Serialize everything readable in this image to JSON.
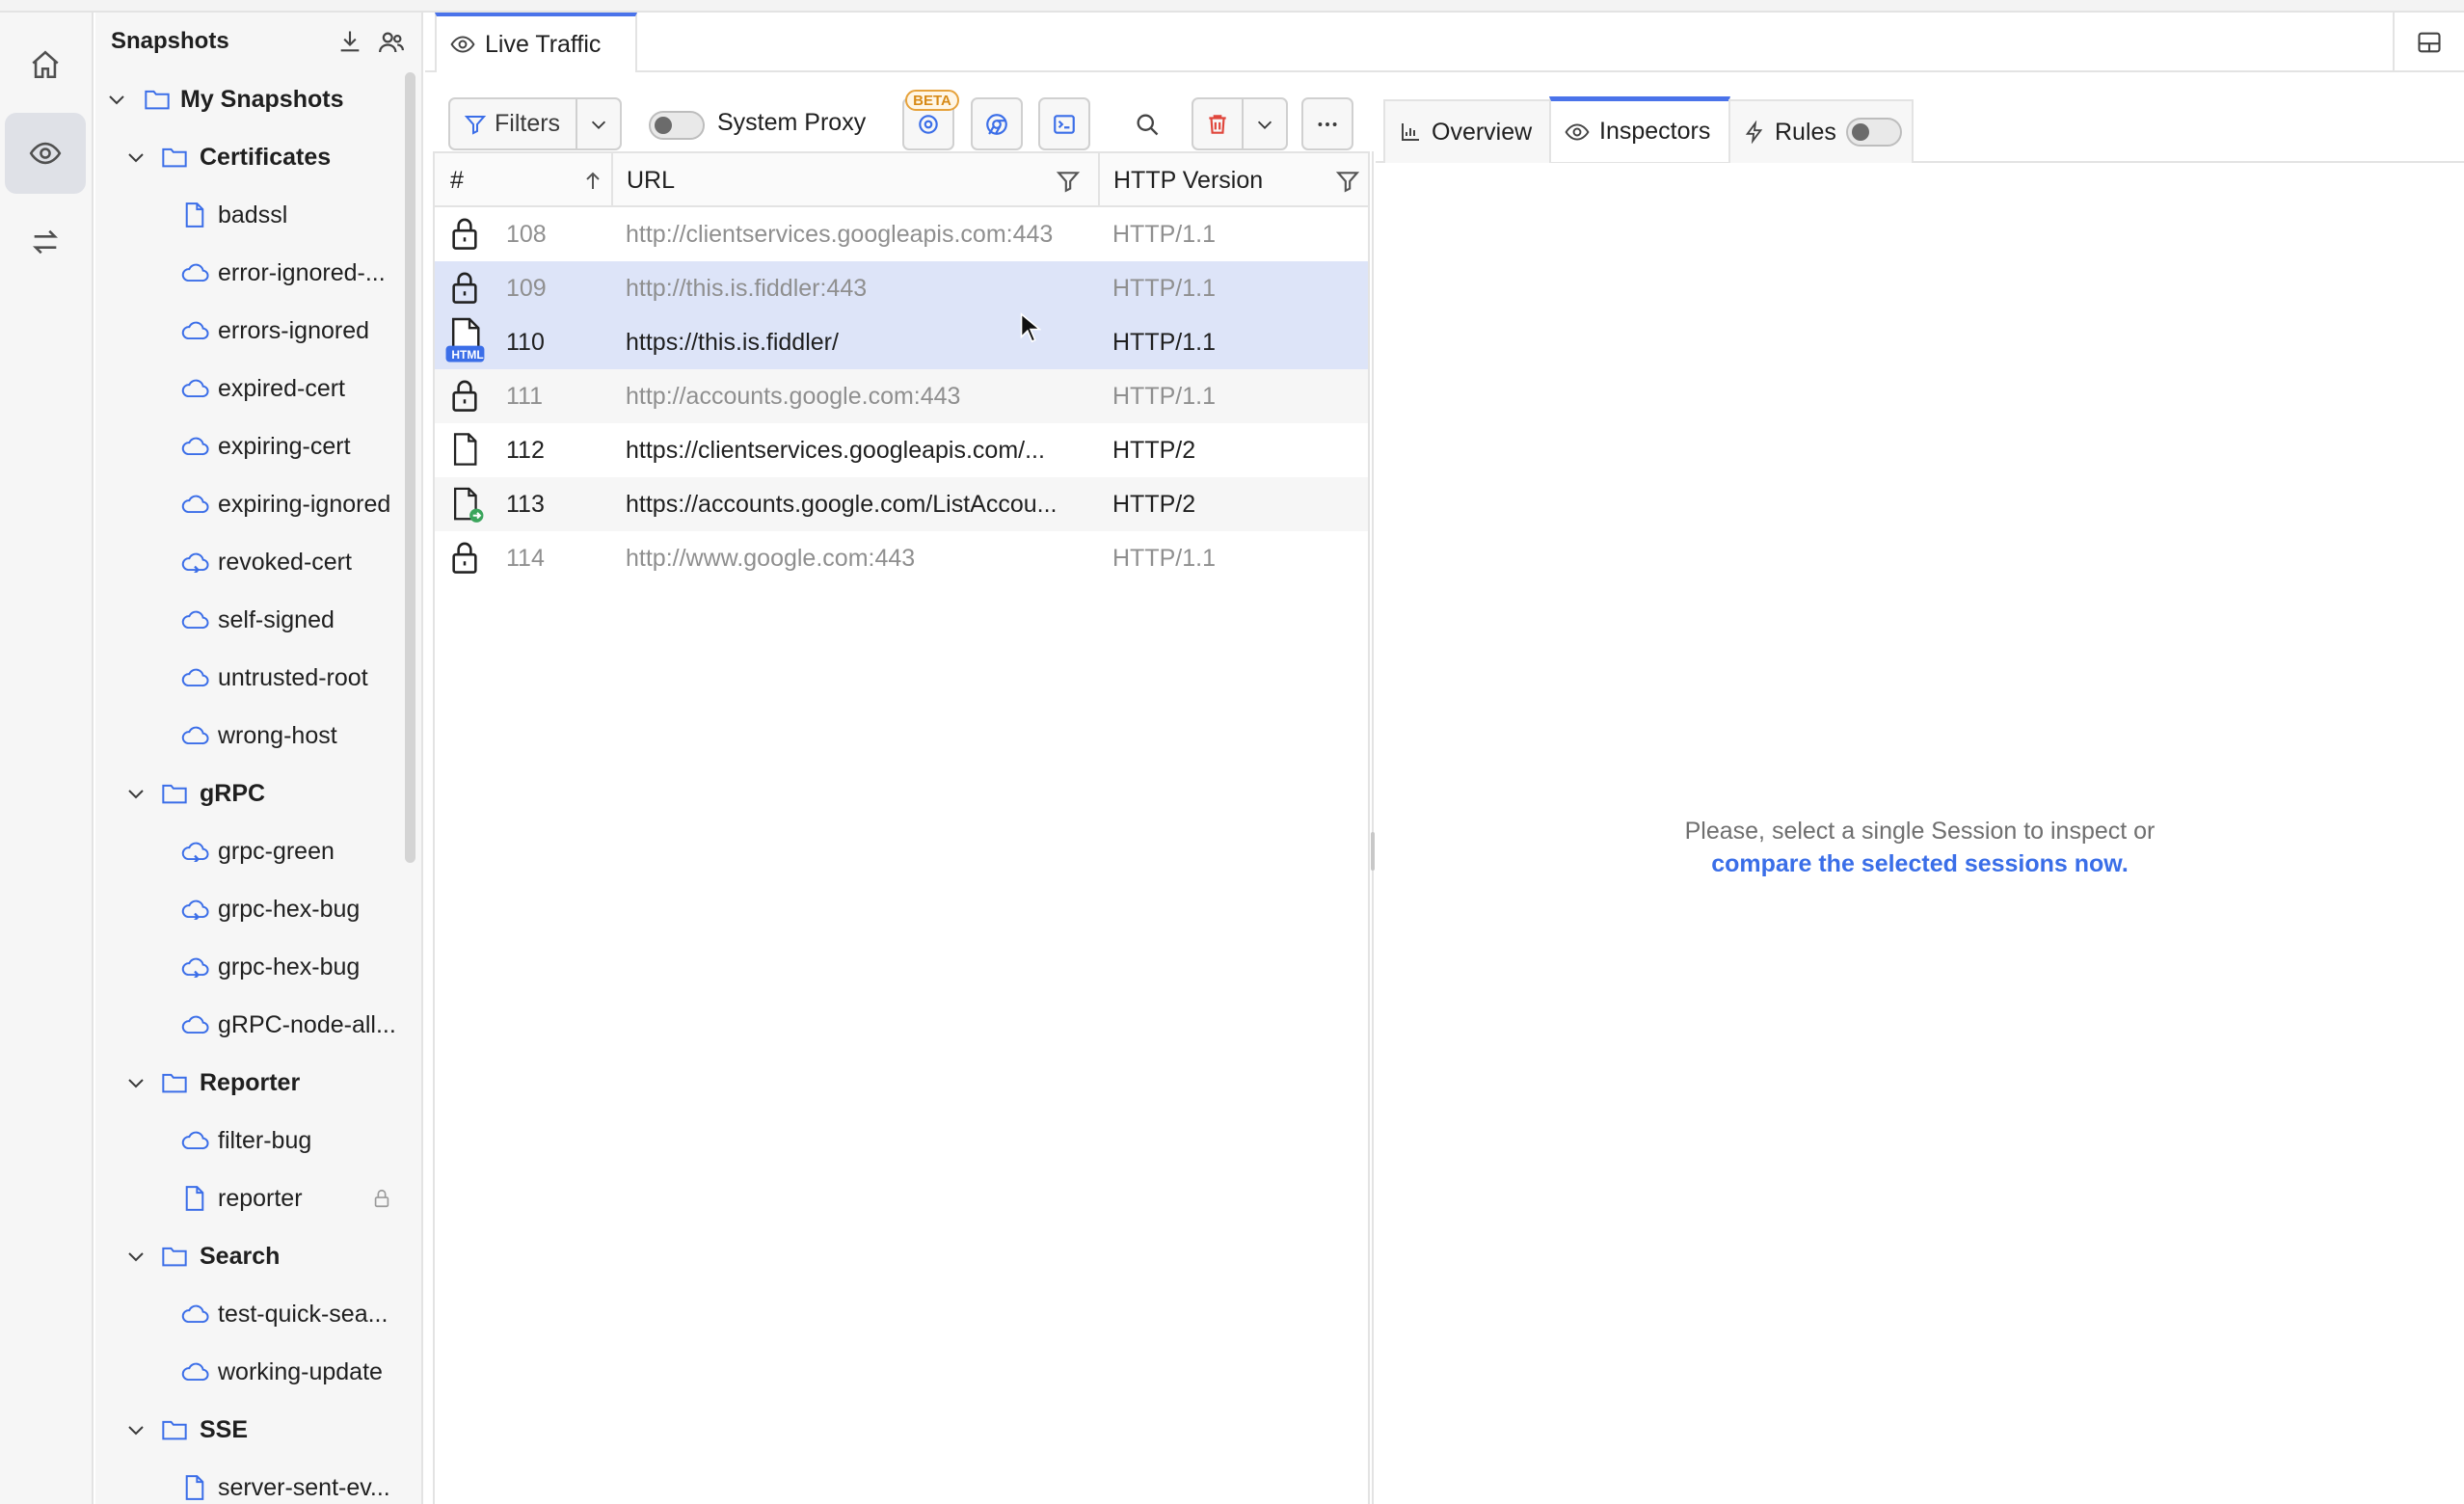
{
  "sidebar": {
    "title": "Snapshots",
    "root": "My Snapshots",
    "items": [
      {
        "label": "Certificates",
        "type": "folder"
      },
      {
        "label": "badssl",
        "type": "file"
      },
      {
        "label": "error-ignored-...",
        "type": "cloud"
      },
      {
        "label": "errors-ignored",
        "type": "cloud"
      },
      {
        "label": "expired-cert",
        "type": "cloud"
      },
      {
        "label": "expiring-cert",
        "type": "cloud"
      },
      {
        "label": "expiring-ignored",
        "type": "cloud"
      },
      {
        "label": "revoked-cert",
        "type": "cloud-sync"
      },
      {
        "label": "self-signed",
        "type": "cloud"
      },
      {
        "label": "untrusted-root",
        "type": "cloud"
      },
      {
        "label": "wrong-host",
        "type": "cloud"
      },
      {
        "label": "gRPC",
        "type": "folder"
      },
      {
        "label": "grpc-green",
        "type": "cloud-sync"
      },
      {
        "label": "grpc-hex-bug",
        "type": "cloud-sync"
      },
      {
        "label": "grpc-hex-bug",
        "type": "cloud-sync"
      },
      {
        "label": "gRPC-node-all...",
        "type": "cloud"
      },
      {
        "label": "Reporter",
        "type": "folder"
      },
      {
        "label": "filter-bug",
        "type": "cloud"
      },
      {
        "label": "reporter",
        "type": "file-locked"
      },
      {
        "label": "Search",
        "type": "folder"
      },
      {
        "label": "test-quick-sea...",
        "type": "cloud"
      },
      {
        "label": "working-update",
        "type": "cloud"
      },
      {
        "label": "SSE",
        "type": "folder"
      },
      {
        "label": "server-sent-ev...",
        "type": "file"
      }
    ]
  },
  "tabs": {
    "live_traffic": "Live Traffic"
  },
  "toolbar": {
    "filters": "Filters",
    "system_proxy": "System Proxy",
    "beta": "BETA"
  },
  "grid": {
    "headers": {
      "num": "#",
      "url": "URL",
      "http": "HTTP Version"
    },
    "rows": [
      {
        "num": "108",
        "url": "http://clientservices.googleapis.com:443",
        "http": "HTTP/1.1",
        "icon": "lock",
        "style": "dim",
        "state": "plain"
      },
      {
        "num": "109",
        "url": "http://this.is.fiddler:443",
        "http": "HTTP/1.1",
        "icon": "lock",
        "style": "dim",
        "state": "selected"
      },
      {
        "num": "110",
        "url": "https://this.is.fiddler/",
        "http": "HTTP/1.1",
        "icon": "html",
        "style": "dark",
        "state": "selected"
      },
      {
        "num": "111",
        "url": "http://accounts.google.com:443",
        "http": "HTTP/1.1",
        "icon": "lock",
        "style": "dim",
        "state": "alt"
      },
      {
        "num": "112",
        "url": "https://clientservices.googleapis.com/...",
        "http": "HTTP/2",
        "icon": "doc",
        "style": "dark",
        "state": "plain"
      },
      {
        "num": "113",
        "url": "https://accounts.google.com/ListAccou...",
        "http": "HTTP/2",
        "icon": "doc-green",
        "style": "dark",
        "state": "alt"
      },
      {
        "num": "114",
        "url": "http://www.google.com:443",
        "http": "HTTP/1.1",
        "icon": "lock",
        "style": "dim",
        "state": "plain"
      }
    ],
    "html_badge": "HTML"
  },
  "right": {
    "tabs": {
      "overview": "Overview",
      "inspectors": "Inspectors",
      "rules": "Rules"
    },
    "message": "Please, select a single Session to inspect or",
    "link": "compare the selected sessions now."
  },
  "colors": {
    "accent": "#4a73ea",
    "selection": "#dde4f8",
    "link": "#3a6ee8",
    "beta": "#e6a23c"
  }
}
